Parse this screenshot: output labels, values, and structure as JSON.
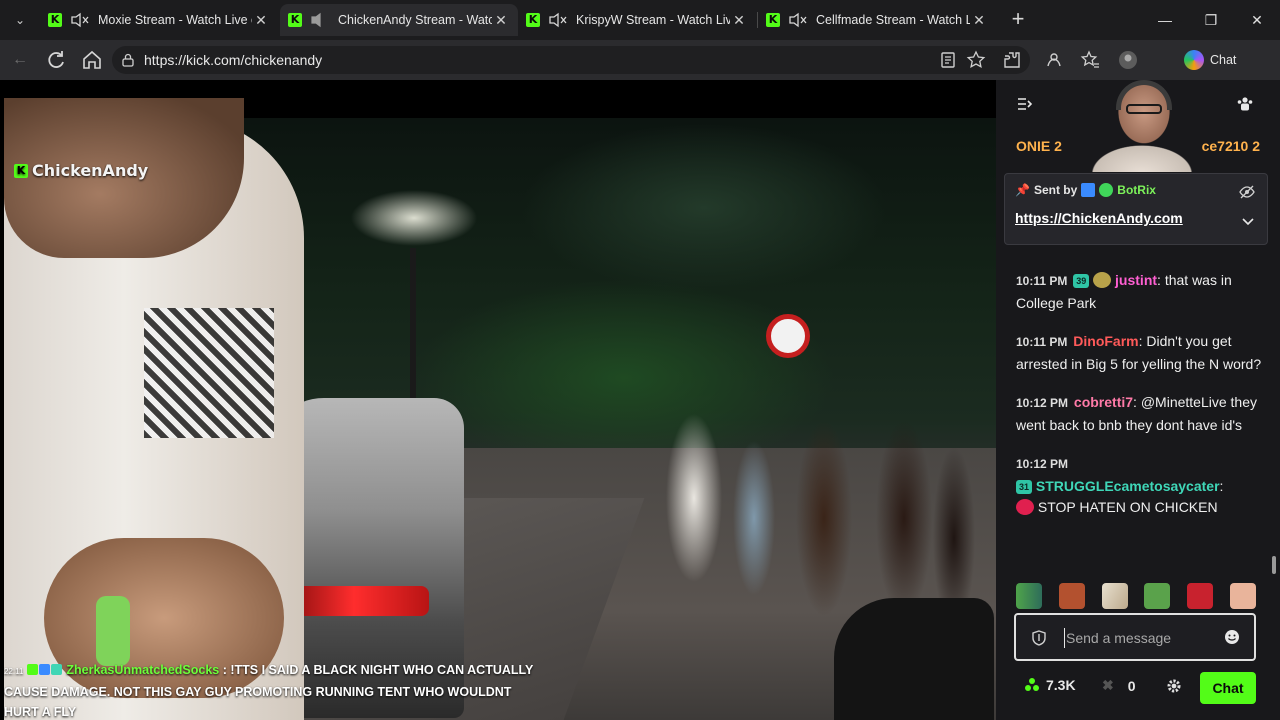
{
  "browser": {
    "tabs": [
      {
        "title": "Moxie Stream - Watch Live on",
        "muted": true
      },
      {
        "title": "ChickenAndy Stream - Watch",
        "muted": false,
        "active": true
      },
      {
        "title": "KrispyW Stream - Watch Live o",
        "muted": true
      },
      {
        "title": "Cellfmade Stream - Watch Live",
        "muted": true
      }
    ],
    "url": "https://kick.com/chickenandy",
    "copilot_label": "Chat",
    "window_controls": {
      "minimize": "—",
      "restore": "❐",
      "close": "✕"
    }
  },
  "video": {
    "watermark": "ChickenAndy",
    "tts": {
      "time": "22:11",
      "username": "ZherkasUnmatchedSocks",
      "separator": " : ",
      "message": "!TTS I SAID A BLACK NIGHT WHO CAN ACTUALLY CAUSE DAMAGE. NOT THIS GAY GUY PROMOTING RUNNING TENT WHO WOULDNT HURT A FLY"
    }
  },
  "chat": {
    "top_chips": [
      "ONIE 2",
      "ce7210 2"
    ],
    "pinned": {
      "sent_by_label": "Sent by",
      "sender": "BotRix",
      "link": "https://ChickenAndy.com"
    },
    "messages": [
      {
        "time": "10:11 PM",
        "badge": "39",
        "user": "justint",
        "user_color": "#ff5fd2",
        "text": "that was in College Park"
      },
      {
        "time": "10:11 PM",
        "badge": "",
        "user": "DinoFarm",
        "user_color": "#ff5a5a",
        "text": "Didn't you get arrested in Big 5 for yelling the N word?"
      },
      {
        "time": "10:12 PM",
        "badge": "",
        "user": "cobretti7",
        "user_color": "#ff7aa8",
        "text": "@MinetteLive they went back to bnb they dont have id's"
      },
      {
        "time": "10:12 PM",
        "badge": "31",
        "user": "STRUGGLEcametosaycater",
        "user_color": "#3fd7b8",
        "text": "STOP HATEN ON CHICKEN"
      }
    ],
    "input_placeholder": "Send a message",
    "viewers": "7.3K",
    "points": "0",
    "send_label": "Chat"
  },
  "colors": {
    "kick_green": "#53fc18",
    "chat_bg": "#18181b"
  }
}
